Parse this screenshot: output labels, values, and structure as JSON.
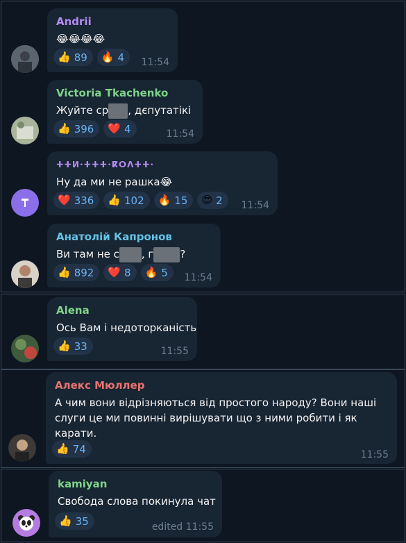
{
  "messages": [
    {
      "sender": "Andrii",
      "sender_color": "#b48cf2",
      "text": "😂😂😂😂",
      "time": "11:54",
      "reactions": [
        {
          "emoji": "👍",
          "count": "89"
        },
        {
          "emoji": "🔥",
          "count": "4"
        }
      ]
    },
    {
      "sender": "Victoria Tkachenko",
      "sender_color": "#7ed389",
      "text_a": "Жуйте ср",
      "text_b": ", дєпутатікі",
      "time": "11:54",
      "reactions": [
        {
          "emoji": "👍",
          "count": "396"
        },
        {
          "emoji": "❤️",
          "count": "4"
        }
      ]
    },
    {
      "sender": "ⵜⵜⵍ·ⵜⵜⵜ·ⴽⵔⴷⵜⵜ·",
      "sender_color": "#b48cf2",
      "text": "Ну да ми не рашка😂",
      "time": "11:54",
      "reactions": [
        {
          "emoji": "❤️",
          "count": "336"
        },
        {
          "emoji": "👍",
          "count": "102"
        },
        {
          "emoji": "🔥",
          "count": "15"
        },
        {
          "emoji": "😍",
          "count": "2"
        }
      ]
    },
    {
      "sender": "Анатолій Капронов",
      "sender_color": "#65c3e6",
      "text_a": "Ви там не с",
      "text_b": ", г",
      "text_c": "?",
      "time": "11:54",
      "reactions": [
        {
          "emoji": "👍",
          "count": "892"
        },
        {
          "emoji": "❤️",
          "count": "8"
        },
        {
          "emoji": "🔥",
          "count": "5"
        }
      ]
    },
    {
      "sender": "Alena",
      "sender_color": "#7ed389",
      "text": "Ось Вам і недоторканість",
      "time": "11:55",
      "reactions": [
        {
          "emoji": "👍",
          "count": "33"
        }
      ]
    },
    {
      "sender": "Алекс Мюллер",
      "sender_color": "#e9736f",
      "text": "А чим вони відрізняються від простого народу? Вони наші слуги це ми повинні вирішувати що з ними робити і як карати.",
      "time": "11:55",
      "reactions": [
        {
          "emoji": "👍",
          "count": "74"
        }
      ]
    },
    {
      "sender": "kamiyan",
      "sender_color": "#7ed389",
      "text": "Свобода слова покинула чат",
      "time": "edited 11:55",
      "reactions": [
        {
          "emoji": "👍",
          "count": "35"
        }
      ]
    }
  ],
  "avatars": {
    "kamiyan": "panda-icon",
    "third": "pin-icon"
  },
  "colors": {
    "background": "#0e1621",
    "bubble": "#182533",
    "reaction_pill": "#223247",
    "reaction_text": "#6ab3f3",
    "time": "#6d7f8f"
  }
}
